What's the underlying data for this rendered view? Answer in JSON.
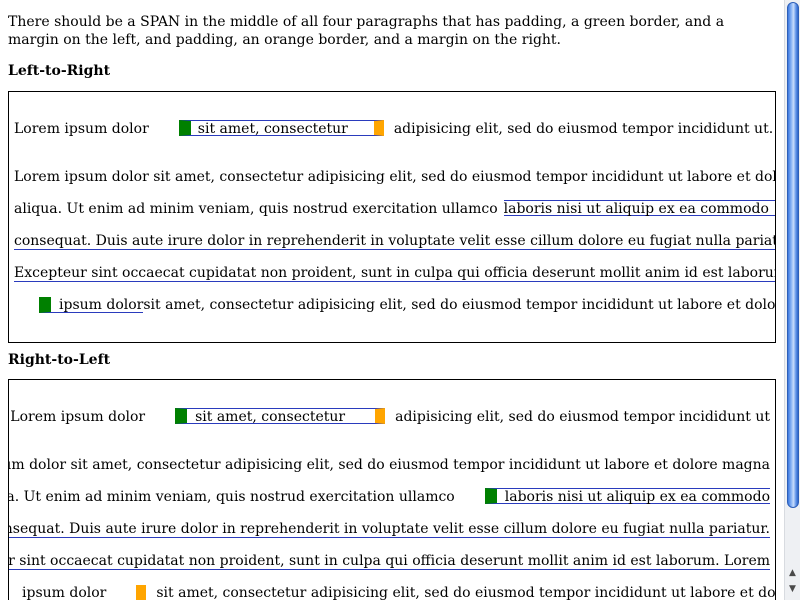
{
  "intro": "There should be a SPAN in the middle of all four paragraphs that has padding, a green border, and a margin on the left, and padding, an orange border, and a margin on the right.",
  "ltr": {
    "heading": "Left-to-Right",
    "p1_pre": "Lorem ipsum dolor",
    "p1_span": "sit amet, consectetur",
    "p1_post": "adipisicing elit, sed do eiusmod tempor incididunt ut.",
    "p2_line1": "Lorem ipsum dolor sit amet, consectetur adipisicing elit, sed do eiusmod tempor incididunt ut labore et dolore magna",
    "p2_line2_pre": "aliqua. Ut enim ad minim veniam, quis nostrud exercitation ullamco",
    "p2_line2_span": "laboris nisi ut aliquip ex ea commodo",
    "p2_line3_span": "consequat. Duis aute irure dolor in reprehenderit in voluptate velit esse cillum dolore eu fugiat nulla pariatur.",
    "p2_line4_span": "Excepteur sint occaecat cupidatat non proident, sunt in culpa qui officia deserunt mollit anim id est laborum. Lorem",
    "p2_line5_span": "ipsum dolor",
    "p2_line5_post": "sit amet, consectetur adipisicing elit, sed do eiusmod tempor incididunt ut labore et dolore"
  },
  "rtl": {
    "heading": "Right-to-Left",
    "p1_pre": ".Lorem ipsum dolor",
    "p1_span": "sit amet, consectetur",
    "p1_post": "adipisicing elit, sed do eiusmod tempor incididunt ut",
    "p2_line1": "Lorem ipsum dolor sit amet, consectetur adipisicing elit, sed do eiusmod tempor incididunt ut labore et dolore magna",
    "p2_line2_pre": "aliqua. Ut enim ad minim veniam, quis nostrud exercitation ullamco",
    "p2_line2_span": "laboris nisi ut aliquip ex ea commodo",
    "p2_line3_span": "consequat. Duis aute irure dolor in reprehenderit in voluptate velit esse cillum dolore eu fugiat nulla pariatur.",
    "p2_line4_span": "Excepteur sint occaecat cupidatat non proident, sunt in culpa qui officia deserunt mollit anim id est laborum. Lorem",
    "p2_line5_span": "ipsum dolor",
    "p2_line5_post": "sit amet, consectetur adipisicing elit, sed do eiusmod tempor incididunt ut labore et dolore magna"
  },
  "colors": {
    "left_border": "#008000",
    "right_border": "#ffa500",
    "underline": "#2a3bbd",
    "scroll_thumb": "#5d92e8"
  },
  "scrollbar": {
    "up_icon": "up-arrow-icon",
    "down_icon": "down-arrow-icon"
  }
}
